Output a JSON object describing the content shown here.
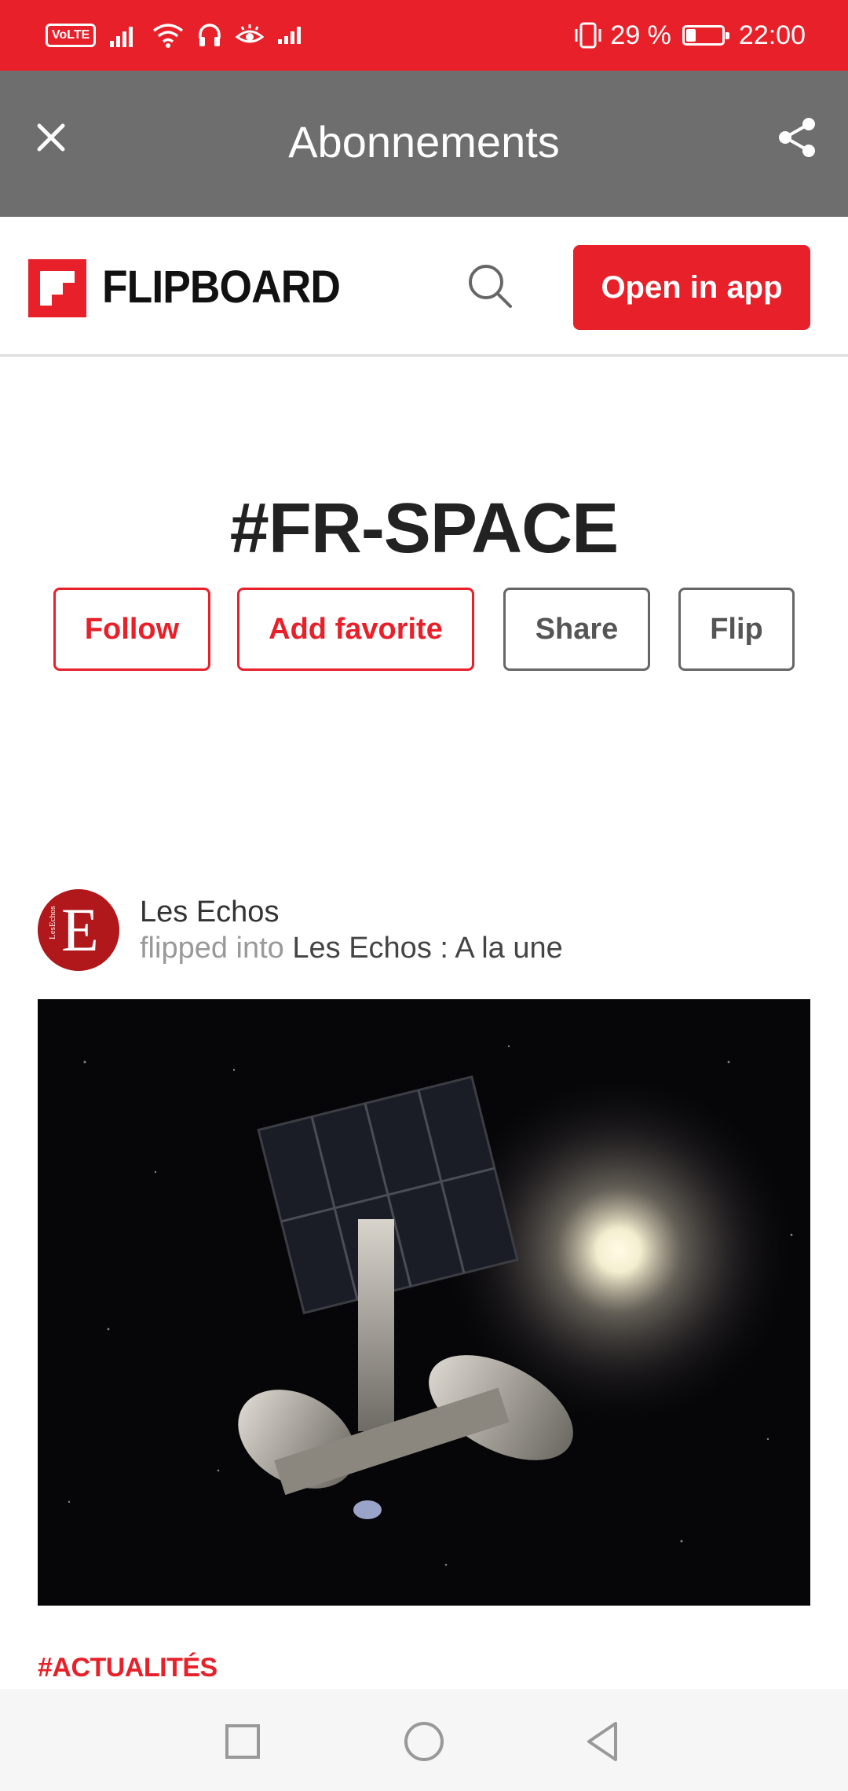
{
  "status_bar": {
    "left_icons": [
      "volte-badge",
      "signal-icon",
      "wifi-icon",
      "headset-icon",
      "eye-comfort-icon",
      "data-activity-icon"
    ],
    "volte_label": "VoLTE",
    "vibrate_icon": "vibrate-icon",
    "battery_percent_text": "29 %",
    "battery_level": 0.29,
    "time": "22:00",
    "background_color": "#e8202a"
  },
  "app_bar": {
    "title": "Abonnements",
    "close_icon": "close-icon",
    "share_icon": "share-icon",
    "background_color": "#6e6e6e"
  },
  "flipboard_header": {
    "logo_text": "FLIPBOARD",
    "search_icon": "search-icon",
    "open_in_app_label": "Open in app",
    "brand_color": "#e8202a"
  },
  "topic": {
    "title": "#FR-SPACE",
    "actions": {
      "follow": "Follow",
      "add_favorite": "Add favorite",
      "share": "Share",
      "flip": "Flip"
    }
  },
  "post": {
    "source_name": "Les Echos",
    "flipped_into_text": "flipped into",
    "magazine_name": "Les Echos : A la une",
    "avatar_letter": "E",
    "avatar_side_text": "LesEchos",
    "image_description_icon": "space-station-image",
    "tag": "#ACTUALITÉS"
  },
  "nav_bar": {
    "recents_icon": "square-recents-icon",
    "home_icon": "circle-home-icon",
    "back_icon": "triangle-back-icon"
  }
}
